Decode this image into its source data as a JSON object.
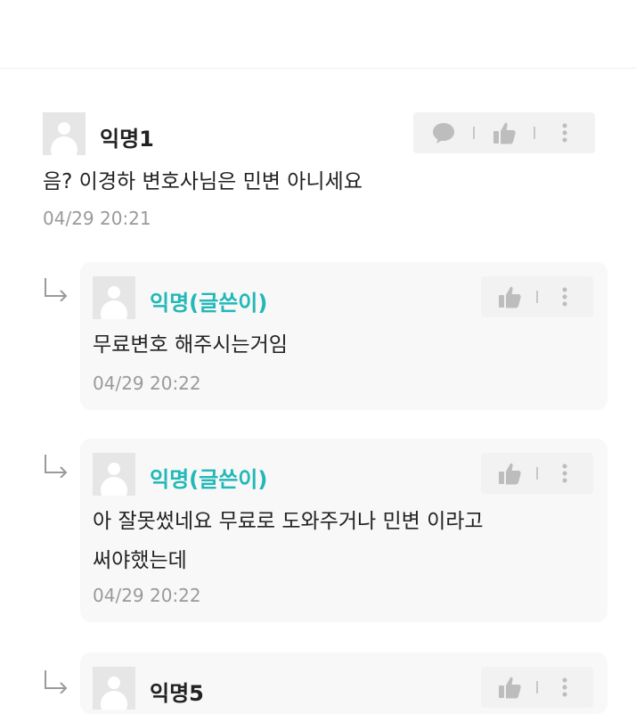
{
  "comments": [
    {
      "author": "익명1",
      "text_lines": [
        "음? 이경하 변호사님은 민변 아니세요"
      ],
      "time": "04/29 20:21"
    }
  ],
  "replies": [
    {
      "author": "익명(글쓴이)",
      "text_lines": [
        "무료변호 해주시는거임"
      ],
      "time": "04/29 20:22"
    },
    {
      "author": "익명(글쓴이)",
      "text_lines": [
        "아 잘못썼네요 무료로 도와주거나 민변 이라고",
        "써야했는데"
      ],
      "time": "04/29 20:22"
    },
    {
      "author": "익명5",
      "text_lines": [],
      "time": ""
    }
  ],
  "colors": {
    "op_author": "#22b8b8",
    "time": "#9a9a9a",
    "reply_bg": "#f8f8f8",
    "action_bg": "#f2f2f2",
    "icon": "#bdbdbd"
  },
  "icons": {
    "comment": "speech-bubble-icon",
    "like": "thumbs-up-icon",
    "more": "vertical-dots-icon",
    "reply": "reply-arrow-icon",
    "avatar": "default-avatar-icon"
  }
}
